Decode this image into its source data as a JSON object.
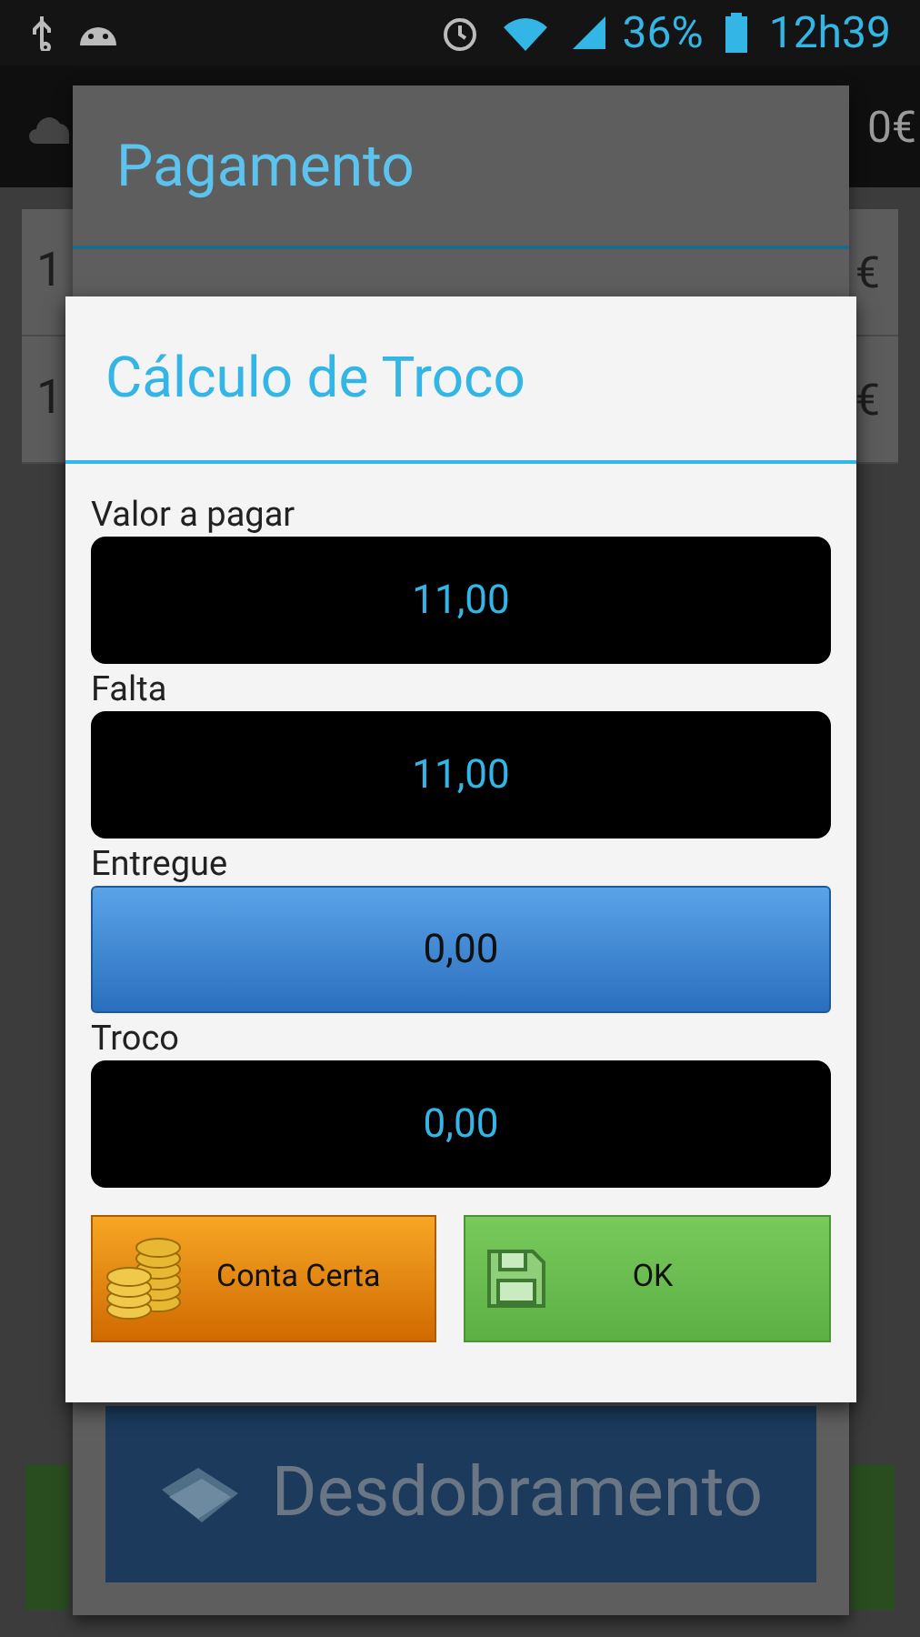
{
  "status_bar": {
    "battery": "36%",
    "time": "12h39"
  },
  "app_bar": {
    "amount": "0€"
  },
  "rows": [
    {
      "quantity": "1",
      "amount": "€"
    },
    {
      "quantity": "1",
      "amount": "€"
    }
  ],
  "payment_dialog": {
    "title": "Pagamento",
    "split_button": "Desdobramento"
  },
  "change_dialog": {
    "title": "Cálculo de Troco",
    "fields": [
      {
        "label": "Valor a pagar",
        "value": "11,00",
        "kind": "display"
      },
      {
        "label": "Falta",
        "value": "11,00",
        "kind": "display"
      },
      {
        "label": "Entregue",
        "value": "0,00",
        "kind": "input"
      },
      {
        "label": "Troco",
        "value": "0,00",
        "kind": "display"
      }
    ],
    "buttons": [
      {
        "label": "Conta Certa",
        "kind": "exact"
      },
      {
        "label": "OK",
        "kind": "ok"
      }
    ]
  }
}
